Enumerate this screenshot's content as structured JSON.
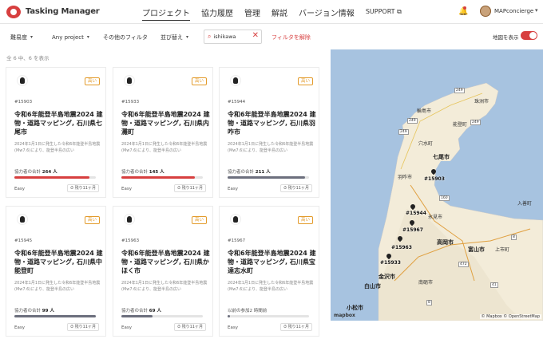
{
  "header": {
    "brand": "Tasking Manager",
    "nav": [
      "プロジェクト",
      "協力履歴",
      "管理",
      "解説",
      "バージョン情報"
    ],
    "support": "SUPPORT ⧉",
    "username": "MAPconcierge"
  },
  "filters": {
    "difficulty": "難易度",
    "any_project": "Any project",
    "other_filters": "その他のフィルタ",
    "sort": "並び替え",
    "search_value": "ishikawa",
    "clear_filters": "フィルタを解除",
    "map_toggle": "地図を表示"
  },
  "results_count": "全 6 中、6 を表示",
  "cards": [
    {
      "badge": "高い",
      "id": "#15903",
      "title": "令和6年能登半島地震2024 建物・道路マッピング, 石川県七尾市",
      "desc": "2024年1月1日に発生した令和6年能登半島地震(Mw7.6)により、能登半島の広い",
      "contrib_label": "協力者の合計",
      "contrib_count": "264 人",
      "progress": 0.92,
      "bar_color": "#d73f3f",
      "difficulty": "Easy",
      "time": "残り11ヶ月"
    },
    {
      "badge": "高い",
      "id": "#15933",
      "title": "令和6年能登半島地震2024 建物・道路マッピング, 石川県内灘町",
      "desc": "2024年1月1日に発生した令和6年能登半島地震(Mw7.6)により、能登半島の広い",
      "contrib_label": "協力者の合計",
      "contrib_count": "145 人",
      "progress": 0.9,
      "bar_color": "#d73f3f",
      "difficulty": "Easy",
      "time": "残り11ヶ月"
    },
    {
      "badge": "高い",
      "id": "#15944",
      "title": "令和6年能登半島地震2024 建物・道路マッピング, 石川県羽咋市",
      "desc": "2024年1月1日に発生した令和6年能登半島地震(Mw7.6)により、能登半島の広い",
      "contrib_label": "協力者の合計",
      "contrib_count": "211 人",
      "progress": 0.95,
      "bar_color": "#6c6f7d",
      "difficulty": "Easy",
      "time": "残り11ヶ月"
    },
    {
      "badge": "高い",
      "id": "#15945",
      "title": "令和6年能登半島地震2024 建物・道路マッピング, 石川県中能登町",
      "desc": "2024年1月1日に発生した令和6年能登半島地震(Mw7.6)により、能登半島の広い",
      "contrib_label": "協力者の合計",
      "contrib_count": "99 人",
      "progress": 1.0,
      "bar_color": "#6c6f7d",
      "difficulty": "Easy",
      "time": "残り11ヶ月"
    },
    {
      "badge": "高い",
      "id": "#15963",
      "title": "令和6年能登半島地震2024 建物・道路マッピング, 石川県かほく市",
      "desc": "2024年1月1日に発生した令和6年能登半島地震(Mw7.6)により、能登半島の広い",
      "contrib_label": "協力者の合計",
      "contrib_count": "69 人",
      "progress": 0.38,
      "bar_color": "#6c6f7d",
      "difficulty": "Easy",
      "time": "残り11ヶ月"
    },
    {
      "badge": "高い",
      "id": "#15967",
      "title": "令和6年能登半島地震2024 建物・道路マッピング, 石川県宝達志水町",
      "desc": "2024年1月1日に発生した令和6年能登半島地震(Mw7.6)により、能登半島の広い",
      "contrib_label": "以前の参加2 時間前",
      "contrib_count": "",
      "progress": 0.03,
      "bar_color": "#6c6f7d",
      "difficulty": "Easy",
      "time": "残り11ヶ月"
    }
  ],
  "map": {
    "pins": [
      "#15903",
      "#15944",
      "#15967",
      "#15963",
      "#15933"
    ],
    "cities": [
      "輪島市",
      "珠洲市",
      "能登町",
      "穴水町",
      "七尾市",
      "羽咋市",
      "氷見市",
      "高岡市",
      "富山市",
      "金沢市",
      "白山市",
      "小松市",
      "南砺市",
      "上市町",
      "入善町"
    ],
    "roads": [
      "249",
      "249",
      "249",
      "249",
      "160",
      "8",
      "472",
      "41",
      "8"
    ],
    "attribution": "© Mapbox © OpenStreetMap",
    "mapbox": "mapbox"
  }
}
